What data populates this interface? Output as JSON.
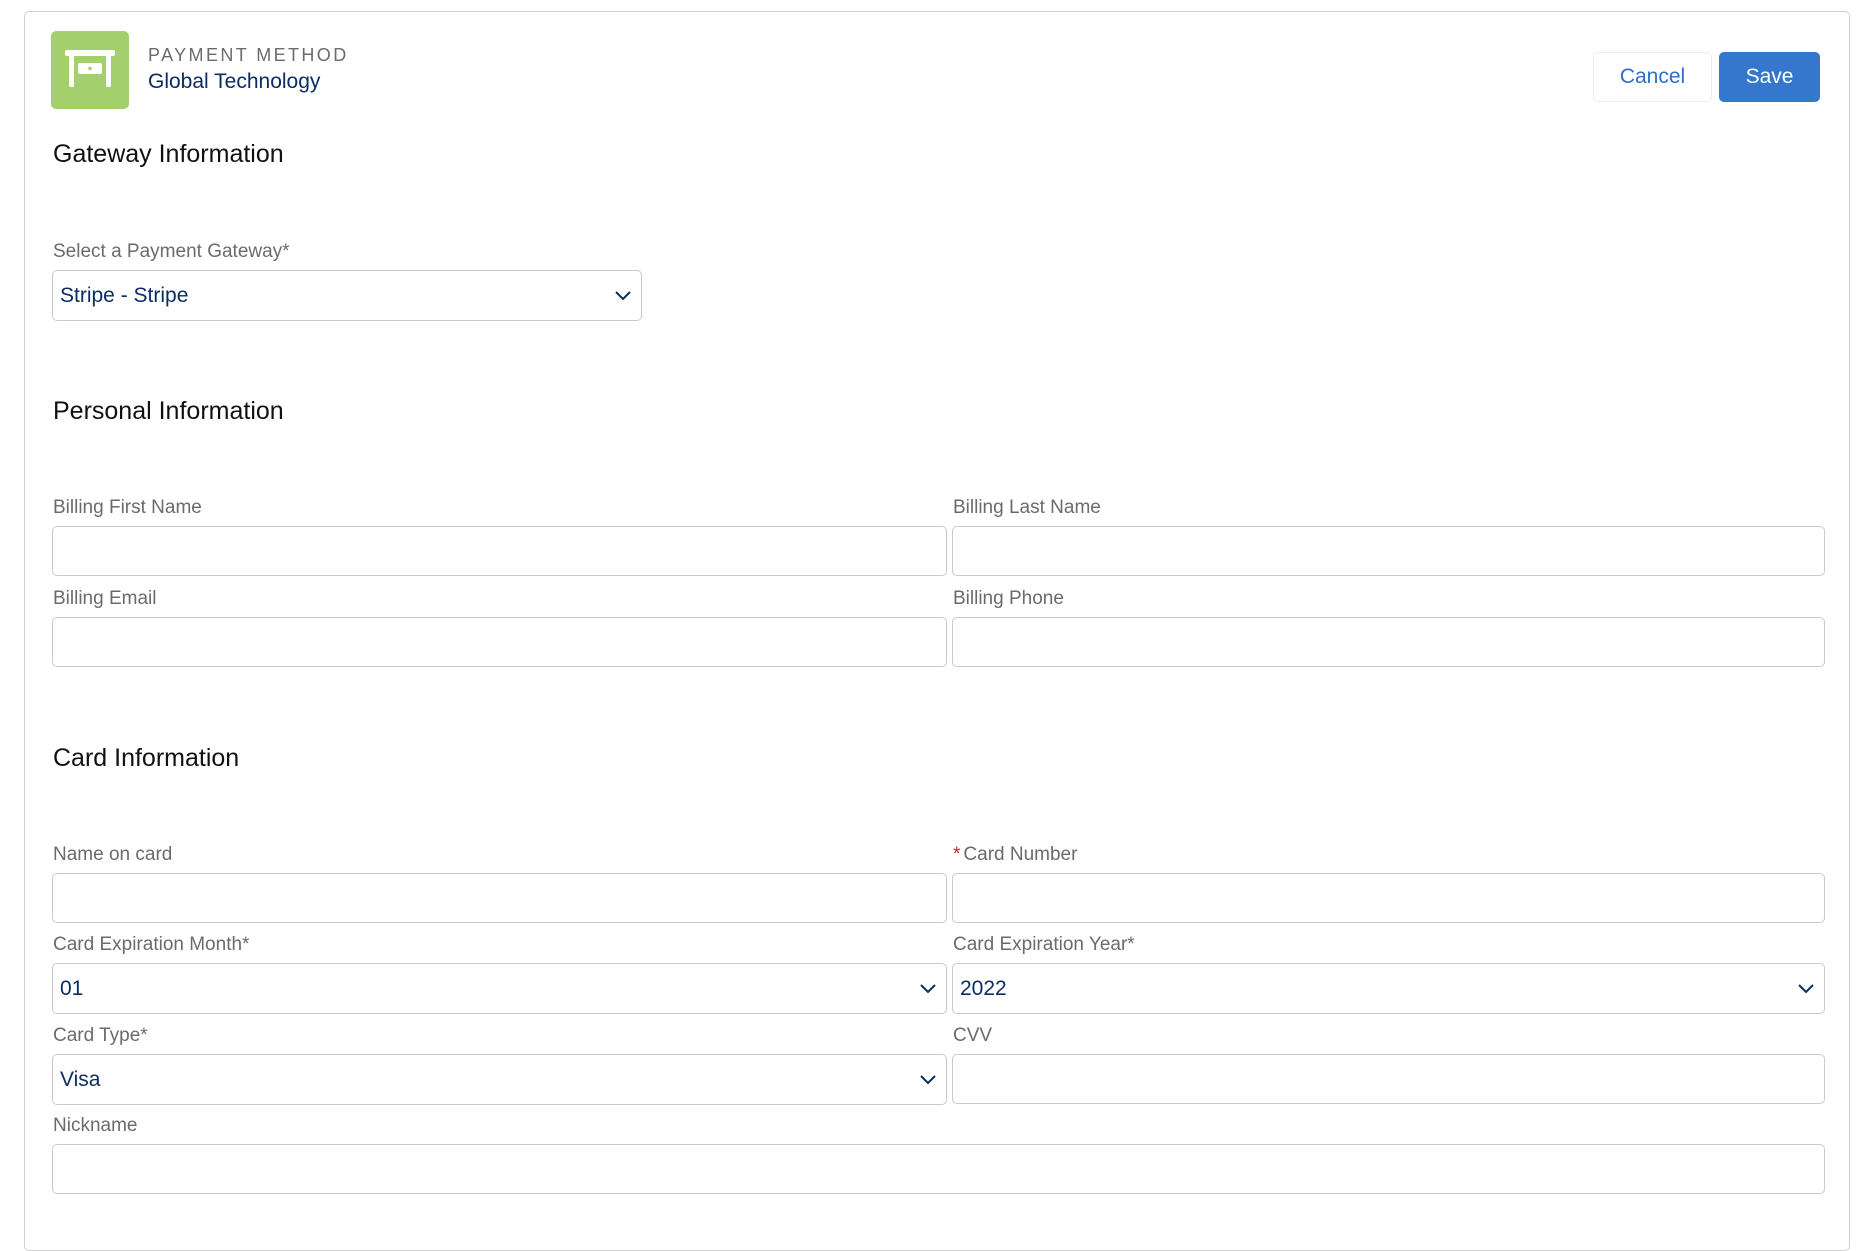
{
  "header": {
    "icon": "table-drawer-icon",
    "object_type": "Payment Method",
    "record_name": "Global Technology",
    "cancel_label": "Cancel",
    "save_label": "Save"
  },
  "colors": {
    "accent": "#3477cc",
    "icon_bg": "#a3cf6d",
    "value_text": "#0b2d63",
    "required": "#d0241b"
  },
  "sections": {
    "gateway": {
      "title": "Gateway Information",
      "gateway_label": "Select a Payment Gateway*",
      "gateway_value": "Stripe - Stripe"
    },
    "personal": {
      "title": "Personal Information",
      "first_name_label": "Billing First Name",
      "first_name_value": "",
      "last_name_label": "Billing Last Name",
      "last_name_value": "",
      "email_label": "Billing Email",
      "email_value": "",
      "phone_label": "Billing Phone",
      "phone_value": ""
    },
    "card": {
      "title": "Card Information",
      "name_label": "Name on card",
      "name_value": "",
      "number_required_marker": "*",
      "number_label": "Card Number",
      "number_value": "",
      "exp_month_label": "Card Expiration Month*",
      "exp_month_value": "01",
      "exp_year_label": "Card Expiration Year*",
      "exp_year_value": "2022",
      "type_label": "Card Type*",
      "type_value": "Visa",
      "cvv_label": "CVV",
      "cvv_value": "",
      "nickname_label": "Nickname",
      "nickname_value": ""
    }
  }
}
